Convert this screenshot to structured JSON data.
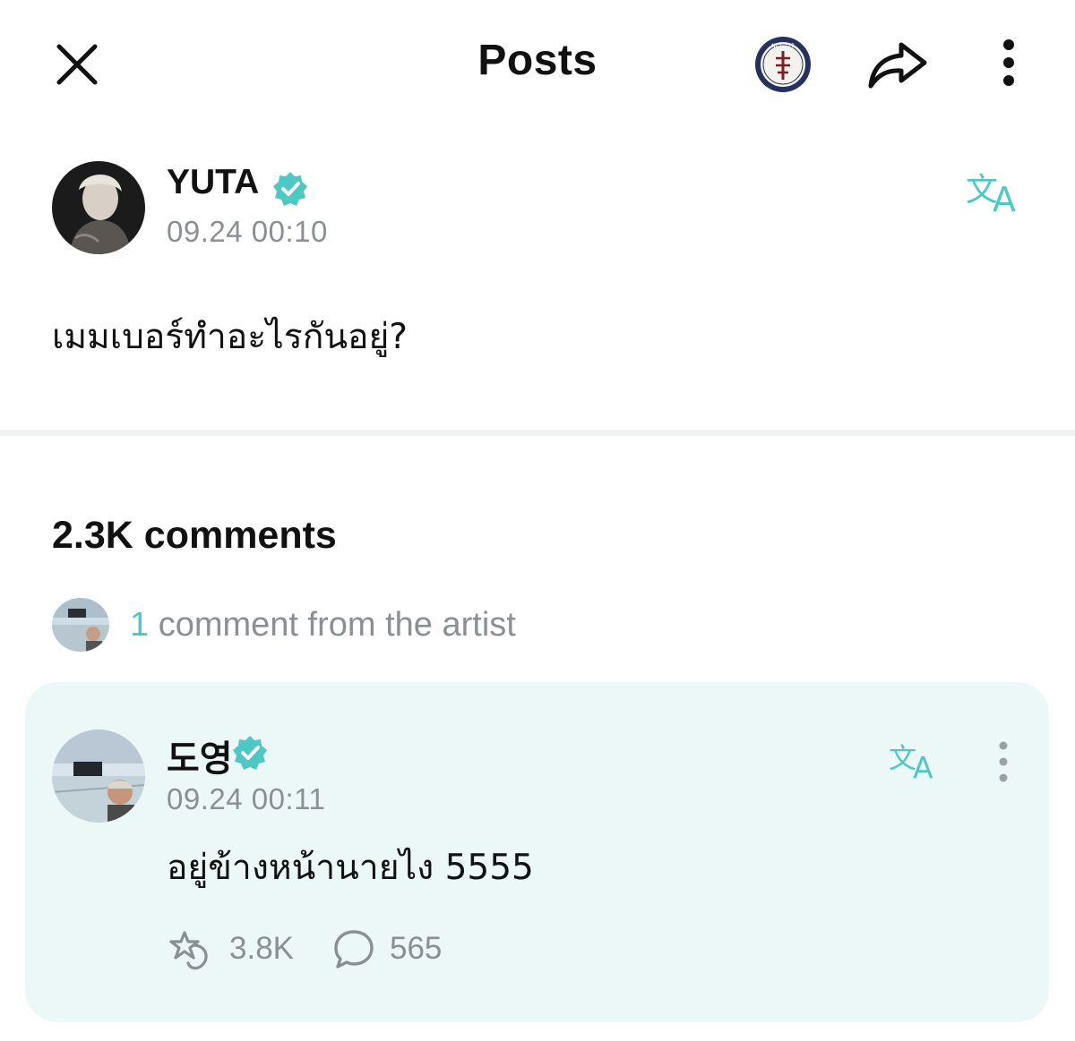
{
  "header": {
    "title": "Posts",
    "icons": [
      "close-icon",
      "community-badge",
      "share-icon",
      "more-vertical-icon"
    ],
    "badge_text": "NCT 127"
  },
  "post": {
    "author": "YUTA",
    "verified": true,
    "time": "09.24 00:10",
    "body": "เมมเบอร์ทำอะไรกันอยู่?",
    "translate_icon": "translate-icon"
  },
  "comments": {
    "count_label": "2.3K comments",
    "artist_summary_number": "1",
    "artist_summary_text": "comment from the artist"
  },
  "artist_comment": {
    "author": "도영",
    "verified": true,
    "time": "09.24 00:11",
    "text": "อยู่ข้างหน้านายไง 5555",
    "reactions": "3.8K",
    "replies": "565"
  },
  "colors": {
    "accent": "#4fc7c4",
    "card_bg": "#ebf8f7",
    "muted_text": "#8a8f96",
    "divider": "#f1f2f4"
  }
}
